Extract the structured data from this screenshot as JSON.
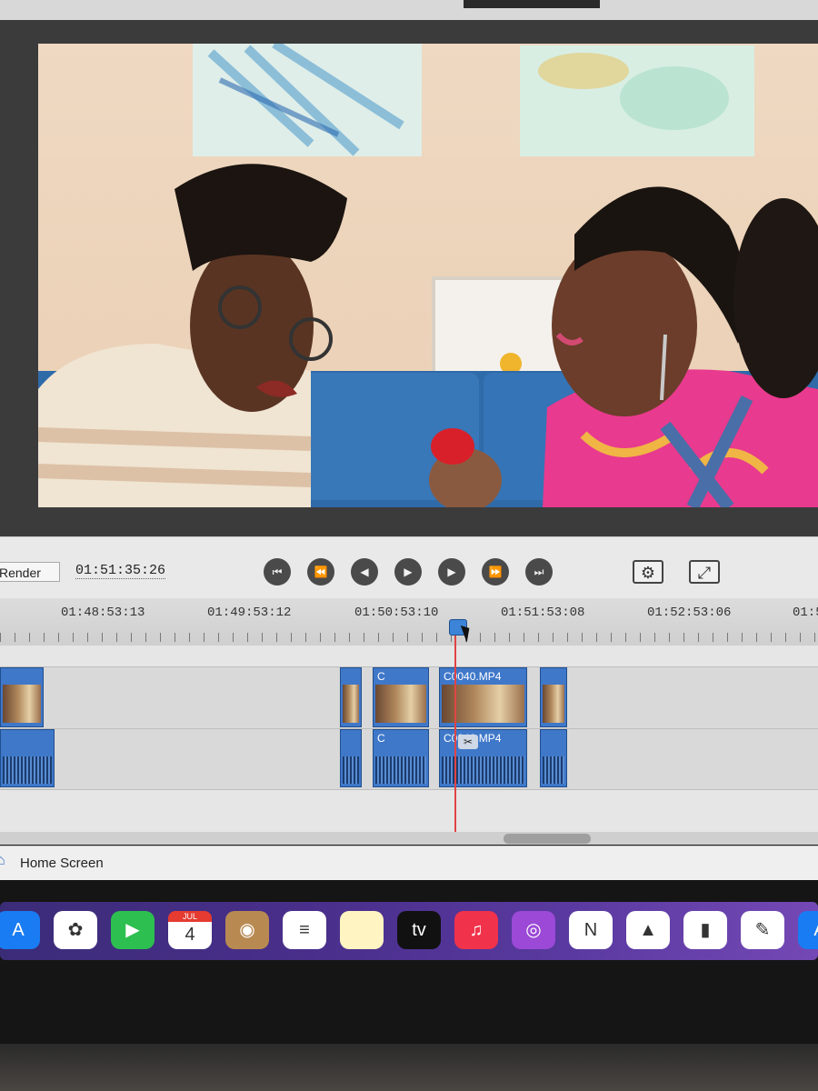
{
  "controls": {
    "render_label": "Render",
    "timecode": "01:51:35:26"
  },
  "transport": [
    {
      "name": "go-to-start",
      "glyph": "⏮"
    },
    {
      "name": "previous-edit",
      "glyph": "⏪"
    },
    {
      "name": "step-back",
      "glyph": "◀"
    },
    {
      "name": "play",
      "glyph": "▶"
    },
    {
      "name": "step-forward",
      "glyph": "▶"
    },
    {
      "name": "next-edit",
      "glyph": "⏩"
    },
    {
      "name": "go-to-end",
      "glyph": "⏭"
    }
  ],
  "view_buttons": [
    {
      "name": "monitor-settings-icon",
      "glyph": "⚙"
    },
    {
      "name": "fullscreen-icon",
      "glyph": "⤢"
    }
  ],
  "ruler": {
    "labels": [
      "01:48:53:13",
      "01:49:53:12",
      "01:50:53:10",
      "01:51:53:08",
      "01:52:53:06",
      "01:5"
    ]
  },
  "timeline": {
    "video_clips": [
      {
        "title": ""
      },
      {
        "title": ""
      },
      {
        "title": "C"
      },
      {
        "title": "C0040.MP4"
      },
      {
        "title": ""
      }
    ],
    "audio_clips": [
      {
        "title": ""
      },
      {
        "title": ""
      },
      {
        "title": "C"
      },
      {
        "title": "C0040.MP4"
      },
      {
        "title": ""
      }
    ]
  },
  "status": {
    "home_label": "Home Screen"
  },
  "dock": [
    {
      "name": "app-store-icon",
      "glyph": "A",
      "color": "#1a7cf2"
    },
    {
      "name": "photos-icon",
      "glyph": "✿",
      "color": "#ffffff"
    },
    {
      "name": "facetime-icon",
      "glyph": "▶",
      "color": "#2dbf4f"
    },
    {
      "name": "calendar-icon",
      "glyph": "4",
      "month": "JUL",
      "color": "#ffffff"
    },
    {
      "name": "contacts-icon",
      "glyph": "◉",
      "color": "#b88a52"
    },
    {
      "name": "reminders-icon",
      "glyph": "≡",
      "color": "#ffffff"
    },
    {
      "name": "notes-icon",
      "glyph": "",
      "color": "#fff4c2"
    },
    {
      "name": "apple-tv-icon",
      "glyph": "tv",
      "color": "#111111"
    },
    {
      "name": "music-icon",
      "glyph": "♫",
      "color": "#f0324a"
    },
    {
      "name": "podcasts-icon",
      "glyph": "◎",
      "color": "#9b49d6"
    },
    {
      "name": "news-icon",
      "glyph": "N",
      "color": "#ffffff"
    },
    {
      "name": "keynote-icon",
      "glyph": "▲",
      "color": "#ffffff"
    },
    {
      "name": "numbers-icon",
      "glyph": "▮",
      "color": "#ffffff"
    },
    {
      "name": "pages-icon",
      "glyph": "✎",
      "color": "#ffffff"
    },
    {
      "name": "app-store-2-icon",
      "glyph": "A",
      "color": "#1a7cf2"
    }
  ]
}
